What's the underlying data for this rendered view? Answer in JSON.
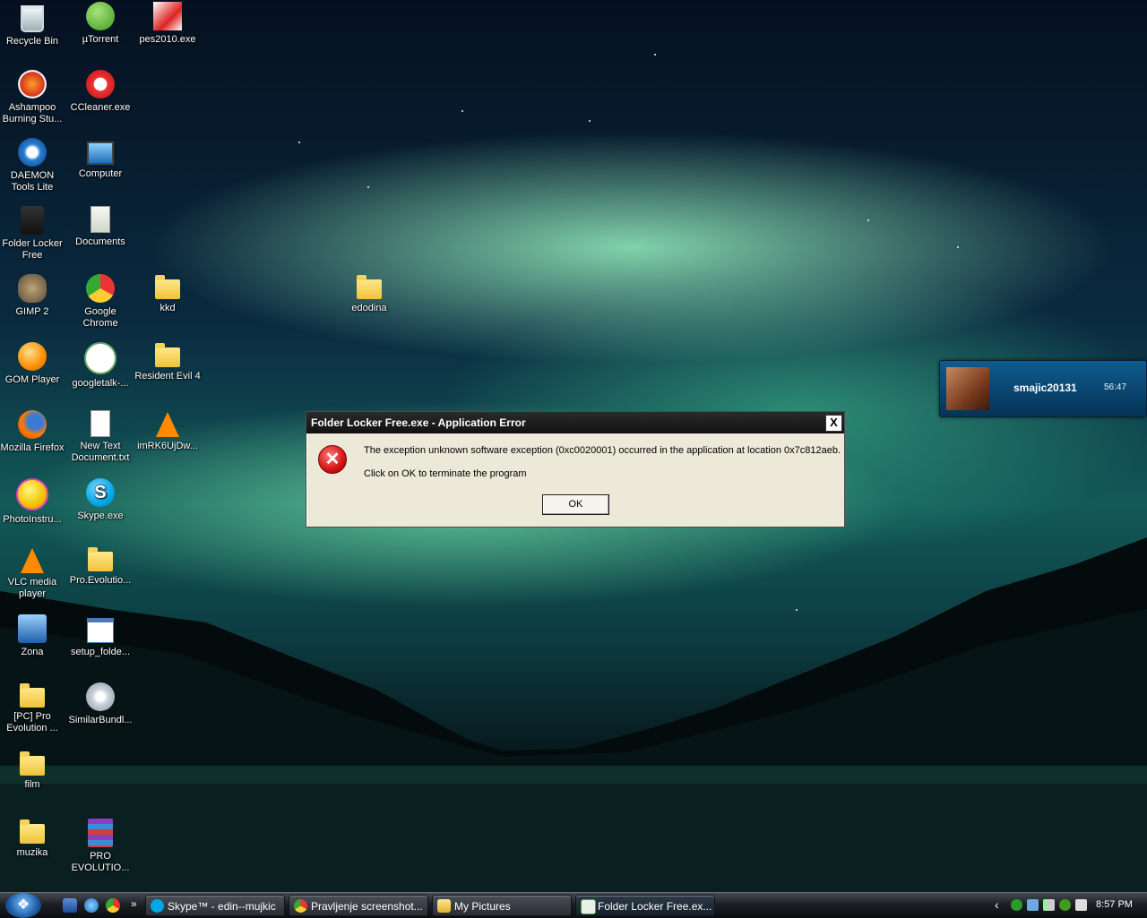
{
  "desktop_icons": [
    {
      "label": "Recycle Bin",
      "icon": "recycle-bin-icon"
    },
    {
      "label": "µTorrent",
      "icon": "utorrent-icon"
    },
    {
      "label": "pes2010.exe",
      "icon": "pes2010-icon"
    },
    {
      "label": "Ashampoo Burning Stu...",
      "icon": "ashampoo-icon"
    },
    {
      "label": "CCleaner.exe",
      "icon": "ccleaner-icon"
    },
    {
      "label": "DAEMON Tools Lite",
      "icon": "daemon-tools-icon"
    },
    {
      "label": "Computer",
      "icon": "computer-icon"
    },
    {
      "label": "Folder Locker Free",
      "icon": "folder-locker-icon"
    },
    {
      "label": "Documents",
      "icon": "documents-icon"
    },
    {
      "label": "GIMP 2",
      "icon": "gimp-icon"
    },
    {
      "label": "Google Chrome",
      "icon": "chrome-icon"
    },
    {
      "label": "kkd",
      "icon": "folder-icon"
    },
    {
      "label": "edodina",
      "icon": "folder-icon"
    },
    {
      "label": "GOM Player",
      "icon": "gom-player-icon"
    },
    {
      "label": "googletalk-...",
      "icon": "googletalk-icon"
    },
    {
      "label": "Resident Evil 4",
      "icon": "folder-icon"
    },
    {
      "label": "Mozilla Firefox",
      "icon": "firefox-icon"
    },
    {
      "label": "New Text Document.txt",
      "icon": "text-document-icon"
    },
    {
      "label": "imRK6UjDw...",
      "icon": "vlc-file-icon"
    },
    {
      "label": "PhotoInstru...",
      "icon": "photoinstrument-icon"
    },
    {
      "label": "Skype.exe",
      "icon": "skype-icon"
    },
    {
      "label": "VLC media player",
      "icon": "vlc-icon"
    },
    {
      "label": "Pro.Evolutio...",
      "icon": "folder-icon"
    },
    {
      "label": "Zona",
      "icon": "zona-icon"
    },
    {
      "label": "setup_folde...",
      "icon": "setup-window-icon"
    },
    {
      "label": "[PC] Pro Evolution ...",
      "icon": "folder-icon"
    },
    {
      "label": "SimilarBundl...",
      "icon": "installer-disc-icon"
    },
    {
      "label": "film",
      "icon": "folder-icon"
    },
    {
      "label": "muzika",
      "icon": "folder-icon"
    },
    {
      "label": "PRO EVOLUTIO...",
      "icon": "winrar-icon"
    }
  ],
  "dialog": {
    "title": "Folder Locker Free.exe - Application Error",
    "close_label": "X",
    "message": "The exception unknown software exception (0xc0020001) occurred in the application at location 0x7c812aeb.",
    "instruction": "Click on OK to terminate the program",
    "ok_label": "OK"
  },
  "notification": {
    "username": "smajic20131",
    "time": "56:47"
  },
  "taskbar": {
    "more_label": "»",
    "tasks": [
      {
        "label": "Skype™ - edin--mujkic",
        "icon": "skype-icon"
      },
      {
        "label": "Pravljenje screenshot...",
        "icon": "chrome-icon"
      },
      {
        "label": "My Pictures",
        "icon": "folder-window-icon"
      },
      {
        "label": "Folder Locker Free.ex...",
        "icon": "app-window-icon"
      }
    ],
    "tray_arrow": "‹",
    "clock": "8:57 PM"
  },
  "colors": {
    "dialog_bg": "#ece9d8",
    "titlebar": "#1a1a1a",
    "error_red": "#d11414",
    "notify_blue": "#0e5c8f"
  }
}
